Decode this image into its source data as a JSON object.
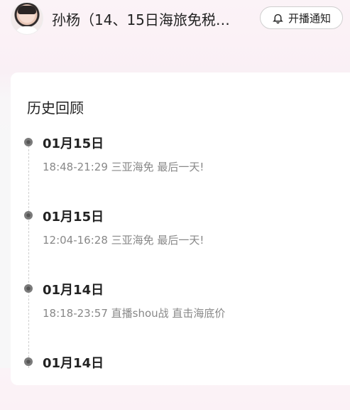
{
  "header": {
    "title": "孙杨（14、15日海旅免税…",
    "notify_label": "开播通知"
  },
  "section_title": "历史回顾",
  "history": [
    {
      "date": "01月15日",
      "desc": "18:48-21:29 三亚海免 最后一天!"
    },
    {
      "date": "01月15日",
      "desc": "12:04-16:28 三亚海免 最后一天!"
    },
    {
      "date": "01月14日",
      "desc": "18:18-23:57 直播shou战 直击海底价"
    },
    {
      "date": "01月14日",
      "desc": ""
    }
  ],
  "colors": {
    "text_primary": "#222222",
    "text_secondary": "#888888",
    "dot": "#7b7b7b"
  }
}
